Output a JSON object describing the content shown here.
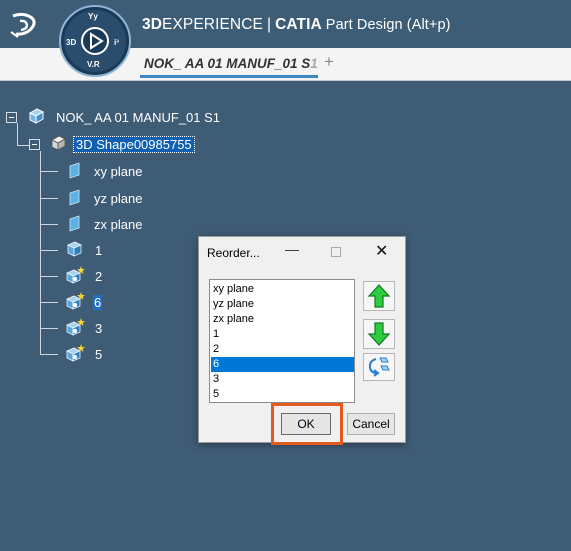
{
  "app": {
    "brand_bold": "3D",
    "brand_rest": "EXPERIENCE",
    "separator": "|",
    "product": "CATIA",
    "module": "Part Design (Alt+p)"
  },
  "compass": {
    "left": "3D",
    "top": "Yy",
    "right": "i³",
    "bottom": "V.R"
  },
  "tab": {
    "label": "NOK_ AA 01 MANUF_01 S",
    "label_fade": "1",
    "add": "+"
  },
  "tree": {
    "root": "NOK_ AA 01 MANUF_01 S1",
    "shape": "3D Shape00985755",
    "items": [
      {
        "label": "xy plane",
        "icon": "plane-icon"
      },
      {
        "label": "yz plane",
        "icon": "plane-icon"
      },
      {
        "label": "zx plane",
        "icon": "plane-icon"
      },
      {
        "label": "1",
        "icon": "body-icon"
      },
      {
        "label": "2",
        "icon": "geometric-set-icon"
      },
      {
        "label": "6",
        "icon": "geometric-set-icon"
      },
      {
        "label": "3",
        "icon": "geometric-set-icon"
      },
      {
        "label": "5",
        "icon": "geometric-set-icon"
      }
    ]
  },
  "dialog": {
    "title": "Reorder...",
    "minimize": "—",
    "close": "✕",
    "list": [
      "xy plane",
      "yz plane",
      "zx plane",
      "1",
      "2",
      "6",
      "3",
      "5"
    ],
    "selected_index": 5,
    "ok_label": "OK",
    "cancel_label": "Cancel",
    "highlight_color": "#e55b1f"
  },
  "colors": {
    "background": "#3f5c76",
    "accent": "#3d86c8",
    "selection": "#0078d7"
  }
}
